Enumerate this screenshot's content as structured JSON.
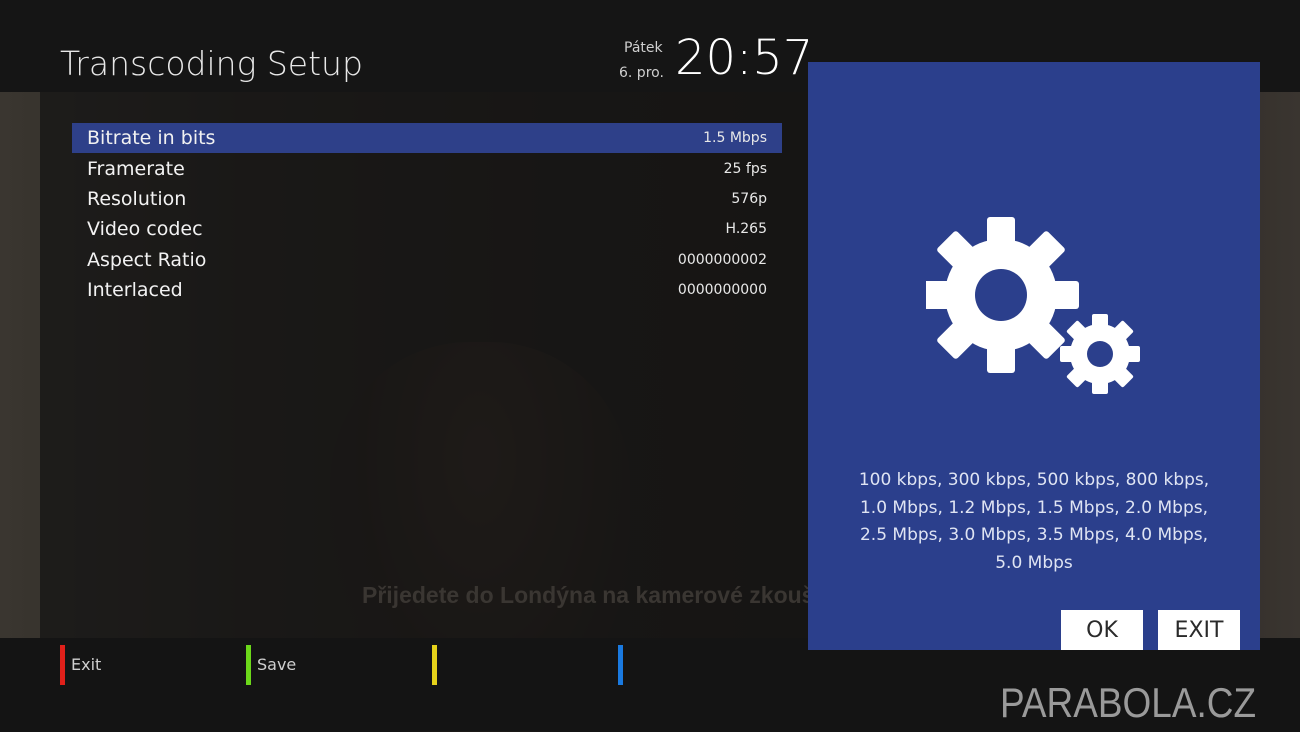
{
  "header": {
    "title": "Transcoding Setup",
    "day": "Pátek",
    "date": "6. pro.",
    "time": "20:57"
  },
  "menu": {
    "items": [
      {
        "label": "Bitrate in bits",
        "value": "1.5 Mbps",
        "selected": true
      },
      {
        "label": "Framerate",
        "value": "25 fps"
      },
      {
        "label": "Resolution",
        "value": "576p"
      },
      {
        "label": "Video codec",
        "value": "H.265"
      },
      {
        "label": "Aspect Ratio",
        "value": "0000000002"
      },
      {
        "label": "Interlaced",
        "value": "0000000000"
      }
    ]
  },
  "info_panel": {
    "icon": "gears-icon",
    "help_text": "100 kbps, 300 kbps, 500 kbps, 800 kbps, 1.0 Mbps, 1.2 Mbps, 1.5 Mbps, 2.0 Mbps, 2.5 Mbps, 3.0 Mbps, 3.5 Mbps, 4.0 Mbps, 5.0 Mbps",
    "ok_label": "OK",
    "exit_label": "EXIT"
  },
  "background": {
    "subtitle": "Přijedete do Londýna na kamerové zkoušky."
  },
  "color_keys": [
    {
      "color": "#e0201a",
      "label": "Exit"
    },
    {
      "color": "#6cd81a",
      "label": "Save"
    },
    {
      "color": "#e6d21a",
      "label": ""
    },
    {
      "color": "#1a7ae0",
      "label": ""
    }
  ],
  "watermark": "PARABOLA.CZ",
  "colors": {
    "selection": "#2e4089",
    "info_panel": "#2b3f8c"
  }
}
